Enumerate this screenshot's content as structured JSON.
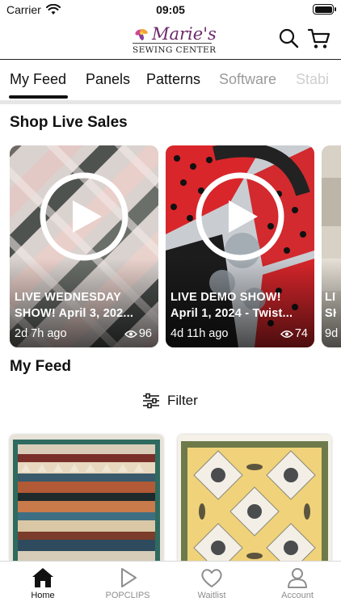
{
  "status_bar": {
    "carrier": "Carrier",
    "time": "09:05"
  },
  "header": {
    "logo_main": "Marie's",
    "logo_sub": "SEWING CENTER"
  },
  "tabs": [
    {
      "label": "My Feed",
      "state": "active"
    },
    {
      "label": "Panels",
      "state": "normal"
    },
    {
      "label": "Patterns",
      "state": "normal"
    },
    {
      "label": "Software",
      "state": "faded"
    },
    {
      "label": "Stabi",
      "state": "ghost"
    }
  ],
  "live_sales": {
    "title": "Shop Live Sales",
    "cards": [
      {
        "title_line1": "LIVE WEDNESDAY",
        "title_line2": "SHOW! April 3, 202...",
        "age": "2d 7h ago",
        "views": "96"
      },
      {
        "title_line1": "LIVE DEMO SHOW!",
        "title_line2": "April 1, 2024 - Twist...",
        "age": "4d 11h ago",
        "views": "74"
      },
      {
        "title_line1": "LIV",
        "title_line2": "SH",
        "age": "9d",
        "views": ""
      }
    ]
  },
  "feed": {
    "title": "My Feed",
    "filter_label": "Filter"
  },
  "bottom_nav": [
    {
      "label": "Home",
      "icon": "home-icon",
      "active": true
    },
    {
      "label": "POPCLIPS",
      "icon": "play-icon",
      "active": false
    },
    {
      "label": "Waitlist",
      "icon": "heart-icon",
      "active": false
    },
    {
      "label": "Account",
      "icon": "person-icon",
      "active": false
    }
  ],
  "colors": {
    "accent": "#111111",
    "brand": "#6d2a6a",
    "inactive": "#8e8e8e"
  }
}
